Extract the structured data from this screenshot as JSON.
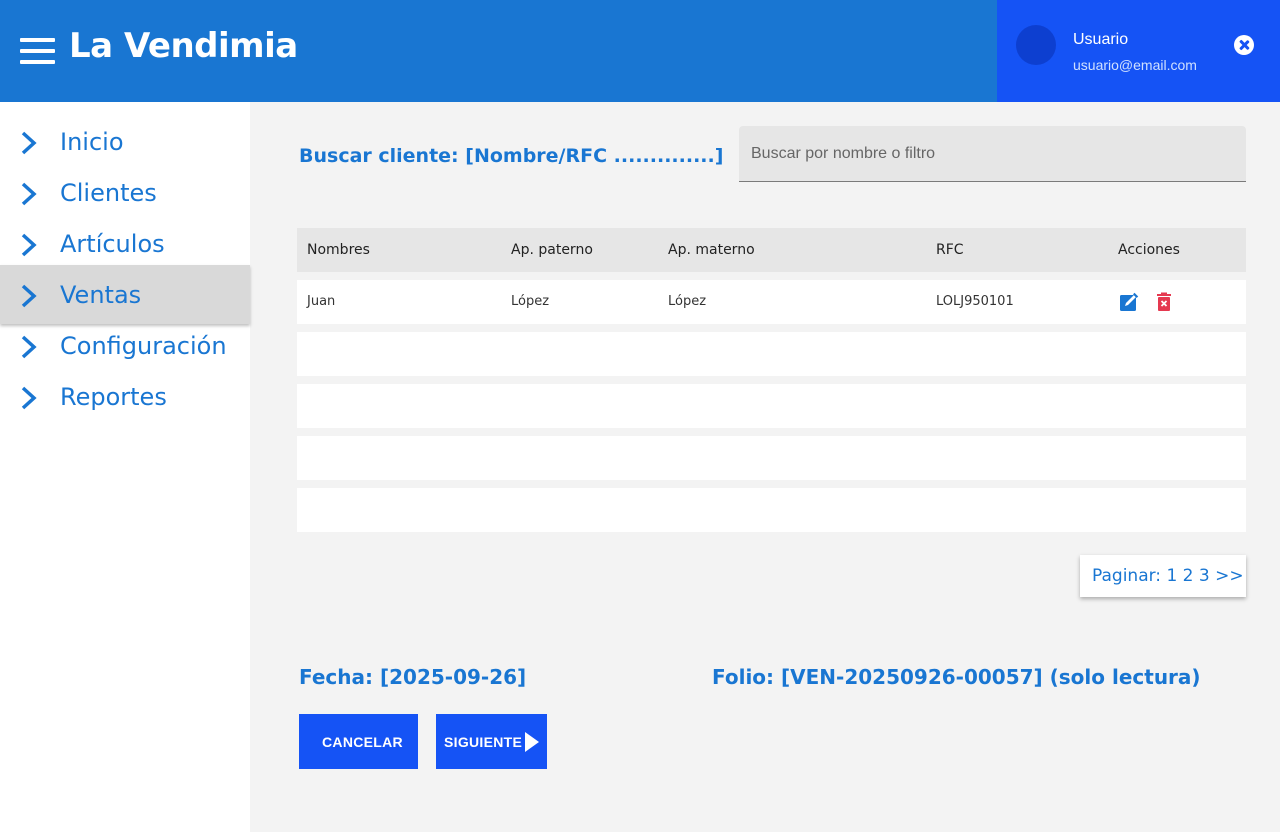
{
  "header": {
    "title": "La Vendimia",
    "user_name": "Usuario",
    "user_email": "usuario@email.com"
  },
  "sidebar": {
    "items": [
      {
        "label": "Inicio",
        "active": false
      },
      {
        "label": "Clientes",
        "active": false
      },
      {
        "label": "Artículos",
        "active": false
      },
      {
        "label": "Ventas",
        "active": true
      },
      {
        "label": "Configuración",
        "active": false
      },
      {
        "label": "Reportes",
        "active": false
      }
    ]
  },
  "search": {
    "label": "Buscar cliente: [Nombre/RFC ..............]",
    "placeholder": "Buscar por nombre o filtro"
  },
  "table": {
    "headers": [
      "Nombres",
      "Ap. paterno",
      "Ap. materno",
      "RFC",
      "Acciones"
    ],
    "rows": [
      [
        "Juan",
        "López",
        "López",
        "LOLJ950101",
        ""
      ],
      [
        "",
        "",
        "",
        "",
        ""
      ],
      [
        "",
        "",
        "",
        "",
        ""
      ],
      [
        "",
        "",
        "",
        "",
        ""
      ],
      [
        "",
        "",
        "",
        "",
        ""
      ]
    ]
  },
  "pagination": {
    "label": "Paginar:",
    "pages": [
      "1",
      "2",
      "3"
    ],
    "next": ">>"
  },
  "footer": {
    "date_label": "Fecha: [2025-09-26]",
    "folio_label": "Folio: [VEN-20250926-00057] (solo lectura)",
    "cancel_label": "CANCELAR",
    "next_label": "SIGUIENTE"
  },
  "colors": {
    "header_bg": "#1976d2",
    "user_panel_bg": "#1553f5",
    "accent": "#1976d2",
    "button_bg": "#1553f5",
    "delete_icon": "#e53950",
    "active_nav_bg": "#d9d9d9"
  },
  "icons": {
    "menu": "hamburger-icon",
    "close": "close-circle-icon",
    "nav": "chevron-right-icon",
    "edit": "edit-icon",
    "delete": "delete-icon",
    "next": "play-icon"
  }
}
